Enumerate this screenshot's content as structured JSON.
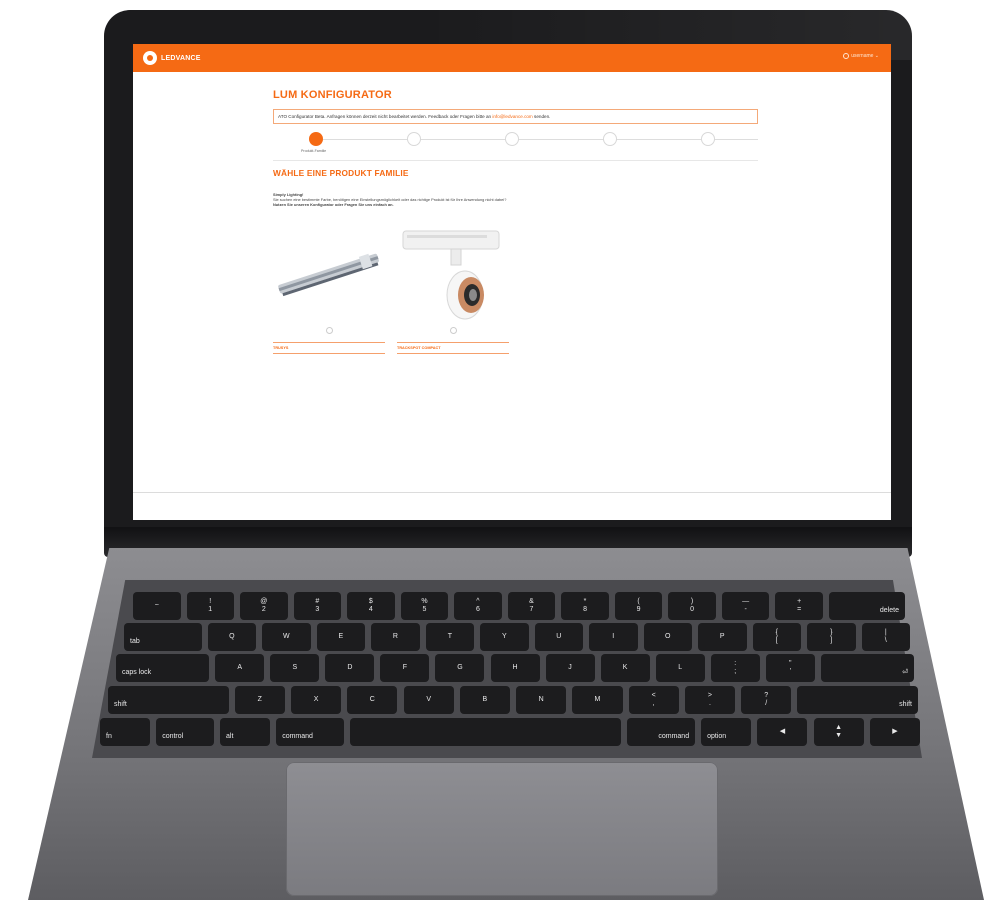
{
  "app": {
    "logo": "LEDVANCE",
    "user_menu": "username ⌄"
  },
  "page": {
    "title": "LUM KONFIGURATOR",
    "notice_text": "ATO Configurator Beta. Anfragen können derzeit nicht bearbeitet werden. Feedback oder Fragen bitte an",
    "notice_link": "info@ledvance.com",
    "notice_suffix": "senden.",
    "steps": [
      {
        "label": "Produkt-Familie",
        "active": true
      },
      {
        "label": "",
        "active": false
      },
      {
        "label": "",
        "active": false
      },
      {
        "label": "",
        "active": false
      },
      {
        "label": "",
        "active": false
      }
    ],
    "section_title": "WÄHLE EINE PRODUKT FAMILIE",
    "intro_heading": "Simply Lighting!",
    "intro_line1": "Sie suchen eine bestimmte Farbe, benötigen eine Einstellungsmöglichkeit oder das richtige Produkt ist für Ihre Anwendung nicht dabei?",
    "intro_line2": "Nutzen Sie unseren Konfigurator oder Fragen Sie uns einfach an.",
    "products": [
      {
        "label": "TRUSYS",
        "image": "linear-luminaire-image"
      },
      {
        "label": "TRACKSPOT COMPACT",
        "image": "track-spot-image"
      }
    ]
  },
  "keyboard": {
    "row1": [
      "~",
      "!\n1",
      "@\n2",
      "#\n3",
      "$\n4",
      "%\n5",
      "^\n6",
      "&\n7",
      "*\n8",
      "(\n9",
      ")\n0",
      "—\n-",
      "+\n=",
      "delete"
    ],
    "row2": [
      "tab",
      "Q",
      "W",
      "E",
      "R",
      "T",
      "Y",
      "U",
      "I",
      "O",
      "P",
      "{\n[",
      "}\n]",
      "|\n\\"
    ],
    "row3": [
      "caps lock",
      "A",
      "S",
      "D",
      "F",
      "G",
      "H",
      "J",
      "K",
      "L",
      ":\n;",
      "\"\n'",
      "⏎"
    ],
    "row4": [
      "shift",
      "Z",
      "X",
      "C",
      "V",
      "B",
      "N",
      "M",
      "<\n,",
      ">\n.",
      "?\n/",
      "shift"
    ],
    "row5": [
      "fn",
      "control",
      "alt",
      "command",
      "",
      "command",
      "option",
      "◀",
      "▲\n▼",
      "▶"
    ]
  },
  "colors": {
    "brand": "#f56a14",
    "laptop_body": "#7b7b80",
    "key": "#1c1c1e"
  }
}
